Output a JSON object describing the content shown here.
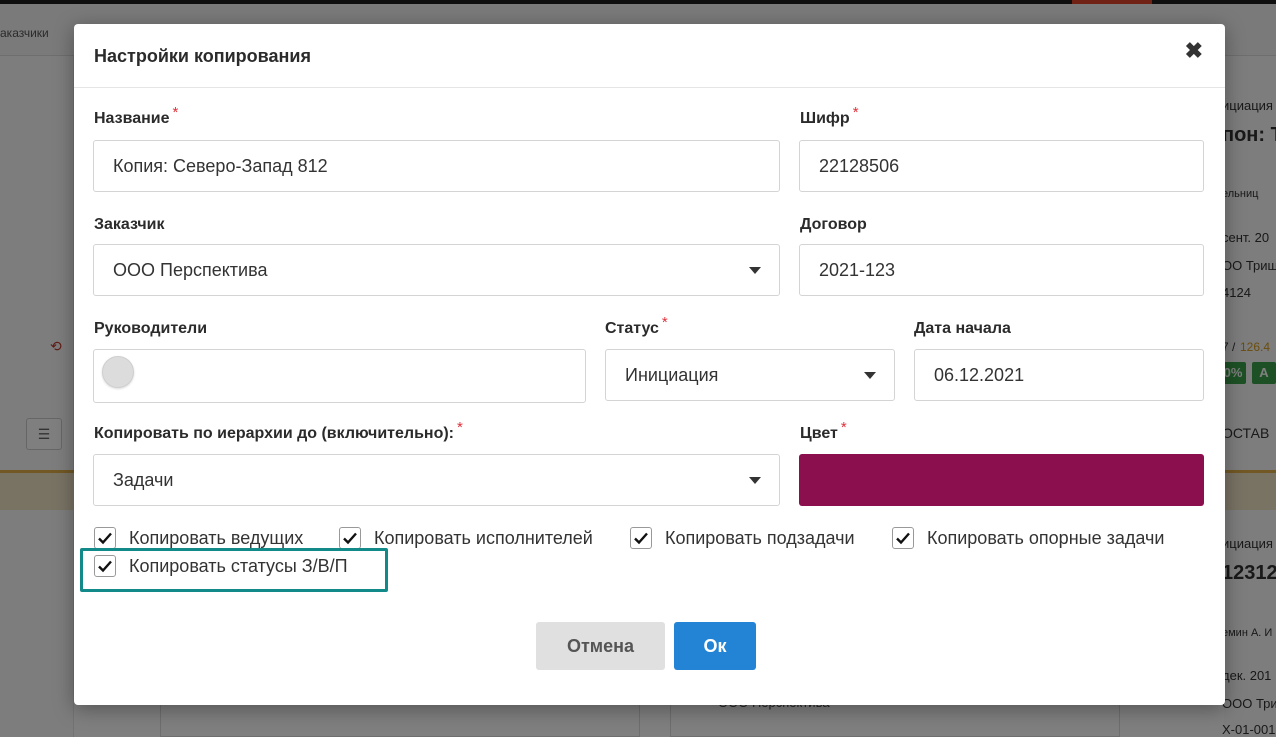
{
  "background": {
    "header_text": "аказчики",
    "right_panel": [
      "ициация",
      "пон: Т",
      "ельниц",
      "сент. 20",
      "ОО Триш",
      "4124",
      "7 / ",
      "126.4",
      "0%",
      "А",
      "ОСТАВ",
      "ициация",
      "12312",
      "емин А. И",
      "дек. 201",
      "ООО Триш",
      "Х-01-001"
    ],
    "bottom_card_text": "ООО Перспектива"
  },
  "modal": {
    "title": "Настройки копирования",
    "close_label": "✖",
    "fields": {
      "name": {
        "label": "Название",
        "value": "Копия: Северо-Запад 812",
        "required": "*"
      },
      "cipher": {
        "label": "Шифр",
        "value": "22128506",
        "required": "*"
      },
      "customer": {
        "label": "Заказчик",
        "value": "ООО Перспектива"
      },
      "contract": {
        "label": "Договор",
        "value": "2021-123"
      },
      "managers": {
        "label": "Руководители"
      },
      "status": {
        "label": "Статус",
        "value": "Инициация",
        "required": "*"
      },
      "start_date": {
        "label": "Дата начала",
        "value": "06.12.2021"
      },
      "hierarchy": {
        "label": "Копировать по иерархии до (включительно):",
        "value": "Задачи",
        "required": "*"
      },
      "color": {
        "label": "Цвет",
        "value": "#8b0f4e",
        "required": "*"
      }
    },
    "checkboxes": [
      {
        "label": "Копировать ведущих",
        "checked": true
      },
      {
        "label": "Копировать исполнителей",
        "checked": true
      },
      {
        "label": "Копировать подзадачи",
        "checked": true
      },
      {
        "label": "Копировать опорные задачи",
        "checked": true
      },
      {
        "label": "Копировать статусы З/В/П",
        "checked": true
      }
    ],
    "buttons": {
      "cancel": "Отмена",
      "ok": "Ок"
    }
  },
  "colors": {
    "accent": "#2384d5",
    "highlight": "#138a8a",
    "required": "#e0303a",
    "swatch": "#8b0f4e"
  }
}
